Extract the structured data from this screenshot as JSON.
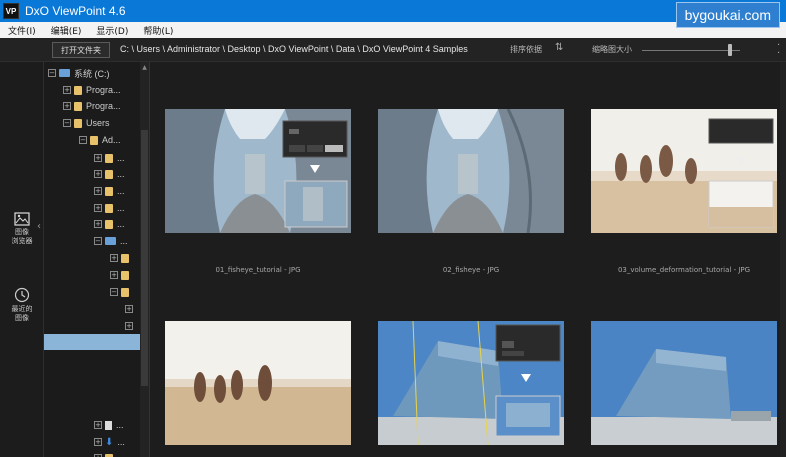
{
  "window": {
    "logo": "VP",
    "title": "DxO ViewPoint 4.6"
  },
  "watermark": "bygoukai.com",
  "menu": [
    "文件(I)",
    "编辑(E)",
    "显示(D)",
    "帮助(L)"
  ],
  "toolbar": {
    "open_folder": "打开文件夹",
    "path": "C: \\ Users \\ Administrator \\ Desktop \\ DxO ViewPoint \\ Data \\ DxO ViewPoint 4 Samples",
    "sort_label": "排序依据",
    "thumb_size_label": "缩略图大小"
  },
  "left_strip": {
    "browser_line1": "图像",
    "browser_line2": "浏览器",
    "recent_line1": "最近的",
    "recent_line2": "图像"
  },
  "tree": {
    "drive": "系统 (C:)",
    "program1": "Progra...",
    "program2": "Progra...",
    "users": "Users",
    "admin": "Ad...",
    "dots": "..."
  },
  "captions": {
    "c1": "01_fisheye_tutorial - JPG",
    "c2": "02_fisheye - JPG",
    "c3": "03_volume_deformation_tutorial - JPG"
  },
  "overlay": {
    "btn_a": "Dist",
    "btn_b": "Perspec",
    "btn_c": "Presp"
  },
  "icons": {
    "sort": "sort-arrows-icon",
    "browser": "image-browser-icon",
    "recent": "clock-icon"
  }
}
